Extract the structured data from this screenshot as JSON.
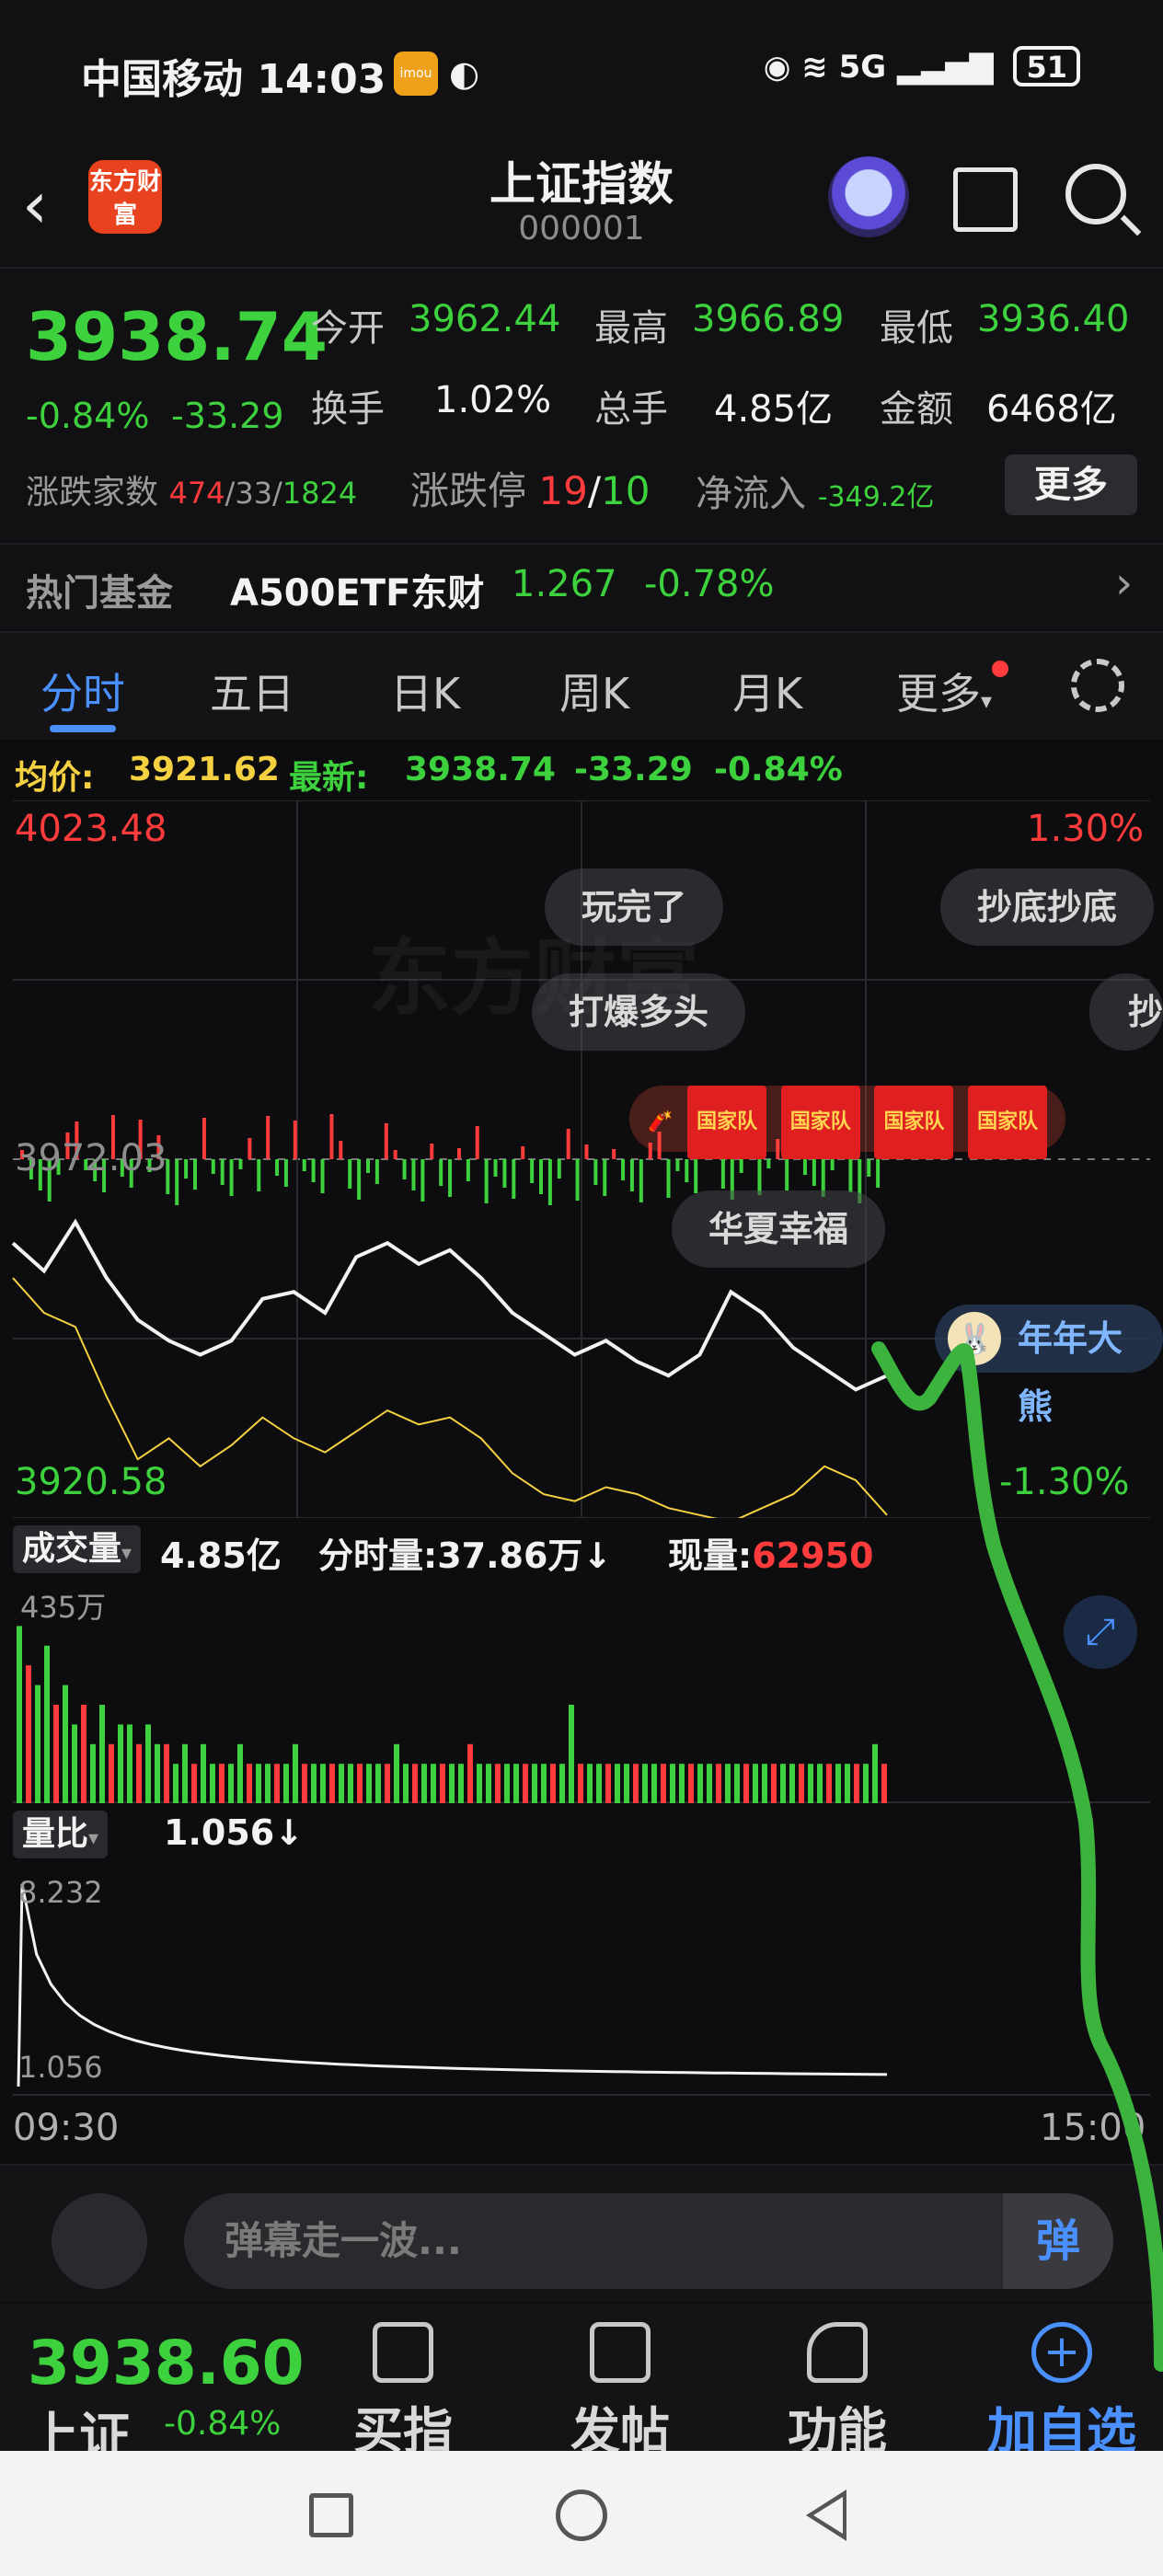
{
  "status_bar": {
    "carrier": "中国移动",
    "time": "14:03",
    "app_badge": "imou",
    "network": "5G",
    "battery": "51"
  },
  "header": {
    "logo_text": "东方财富",
    "title": "上证指数",
    "code": "000001"
  },
  "quote": {
    "price": "3938.74",
    "change_pct": "-0.84%",
    "change": "-33.29",
    "open_label": "今开",
    "open": "3962.44",
    "high_label": "最高",
    "high": "3966.89",
    "low_label": "最低",
    "low": "3936.40",
    "turnover_label": "换手",
    "turnover": "1.02%",
    "volume_label": "总手",
    "volume": "4.85亿",
    "amount_label": "金额",
    "amount": "6468亿",
    "updown_label": "涨跌家数",
    "up_count": "474",
    "flat_count": "33",
    "down_count": "1824",
    "limit_label": "涨跌停",
    "limit_up": "19",
    "limit_down": "10",
    "netflow_label": "净流入",
    "netflow": "-349.2亿",
    "more_button": "更多"
  },
  "hot_fund": {
    "label": "热门基金",
    "name": "A500ETF东财",
    "price": "1.267",
    "change": "-0.78%"
  },
  "tabs": [
    "分时",
    "五日",
    "日K",
    "周K",
    "月K",
    "更多"
  ],
  "chart_header": {
    "avg_label": "均价:",
    "avg": "3921.62",
    "latest_label": "最新:",
    "latest": "3938.74",
    "change": "-33.29",
    "change_pct": "-0.84%"
  },
  "chart_data": {
    "type": "line",
    "y_max": "4023.48",
    "y_mid": "3972.03",
    "y_min": "3920.58",
    "pct_max": "1.30%",
    "pct_min": "-1.30%",
    "watermark": "东方财富",
    "x_start": "09:30",
    "x_end": "15:00",
    "ylim": [
      3920.58,
      4023.48
    ],
    "series": [
      {
        "values": [
          3960,
          3956,
          3963,
          3955,
          3949,
          3946,
          3944,
          3946,
          3952,
          3953,
          3950,
          3958,
          3960,
          3957,
          3959,
          3955,
          3950,
          3947,
          3944,
          3946,
          3943,
          3941,
          3944,
          3953,
          3950,
          3945,
          3942,
          3939,
          3941
        ]
      },
      {
        "values": [
          3955,
          3950,
          3948,
          3938,
          3929,
          3932,
          3928,
          3931,
          3935,
          3932,
          3930,
          3933,
          3936,
          3934,
          3935,
          3932,
          3927,
          3924,
          3923,
          3925,
          3924,
          3922,
          3921,
          3920,
          3922,
          3924,
          3928,
          3926,
          3921
        ]
      }
    ]
  },
  "danmaku": [
    "玩完了",
    "抄底抄底",
    "打爆多头",
    "抄",
    "华夏幸福",
    "年年大熊",
    "国家队"
  ],
  "volume": {
    "label": "成交量",
    "total": "4.85亿",
    "period_label": "分时量:",
    "period": "37.86万",
    "current_label": "现量:",
    "current": "62950",
    "max_tick": "435万",
    "bars": [
      9,
      7,
      6,
      8,
      5,
      6,
      4,
      5,
      3,
      5,
      3,
      4,
      4,
      3,
      4,
      3,
      3,
      2,
      3,
      2,
      3,
      2,
      2,
      2,
      3,
      2,
      2,
      2,
      2,
      2,
      3,
      2,
      2,
      2,
      2,
      2,
      2,
      2,
      2,
      2,
      2,
      3,
      2,
      2,
      2,
      2,
      2,
      2,
      2,
      3,
      2,
      2,
      2,
      2,
      2,
      2,
      2,
      2,
      2,
      2,
      5,
      2,
      2,
      2,
      2,
      2,
      2,
      2,
      2,
      2,
      2,
      2,
      2,
      2,
      2,
      2,
      2,
      2,
      2,
      2,
      2,
      2,
      2,
      2,
      2,
      2,
      2,
      2,
      2,
      2,
      2,
      2,
      2,
      3,
      2
    ]
  },
  "ratio": {
    "label": "量比",
    "value": "1.056",
    "max_tick": "8.232",
    "min_tick": "1.056"
  },
  "input": {
    "placeholder": "弹幕走一波...",
    "button": "弹"
  },
  "bottom_bar": {
    "price": "3938.60",
    "name": "上证",
    "change": "-0.84%",
    "buy": "买指数",
    "post": "发帖",
    "func": "功能",
    "add": "加自选"
  },
  "colors": {
    "up": "#ff3b3b",
    "down": "#3dd13d",
    "accent": "#4a90ff",
    "avg_line": "#f5d142"
  }
}
